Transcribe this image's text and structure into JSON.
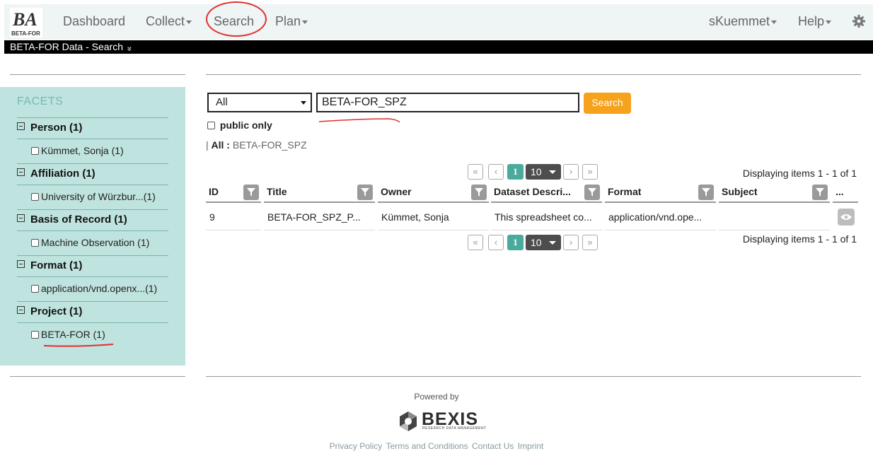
{
  "navbar": {
    "logo_text": "BA",
    "logo_sub": "BETA-FOR",
    "items": [
      {
        "label": "Dashboard",
        "has_caret": false
      },
      {
        "label": "Collect",
        "has_caret": true
      },
      {
        "label": "Search",
        "has_caret": false
      },
      {
        "label": "Plan",
        "has_caret": true
      }
    ],
    "user": "sKuemmet",
    "help": "Help"
  },
  "subbar": {
    "title": "BETA-FOR Data - Search",
    "chevron": "»"
  },
  "facets": {
    "title": "FACETS",
    "groups": [
      {
        "head": "Person (1)",
        "item": "Kümmet, Sonja (1)"
      },
      {
        "head": "Affiliation (1)",
        "item": "University of Würzbur...(1)"
      },
      {
        "head": "Basis of Record (1)",
        "item": "Machine Observation (1)"
      },
      {
        "head": "Format (1)",
        "item": "application/vnd.openx...(1)"
      },
      {
        "head": "Project (1)",
        "item": "BETA-FOR (1)"
      }
    ]
  },
  "search": {
    "category": "All",
    "query": "BETA-FOR_SPZ",
    "button": "Search",
    "public_only": "public only",
    "crumb_label": "All :",
    "crumb_value": "BETA-FOR_SPZ"
  },
  "pager": {
    "first": "«",
    "prev": "‹",
    "current": "1",
    "page_size": "10",
    "next": "›",
    "last": "»",
    "display": "Displaying items 1 - 1 of 1"
  },
  "table": {
    "headers": [
      "ID",
      "Title",
      "Owner",
      "Dataset Descri...",
      "Format",
      "Subject",
      "..."
    ],
    "row": [
      "9",
      "BETA-FOR_SPZ_P...",
      "Kümmet, Sonja",
      "This spreadsheet co...",
      "application/vnd.ope..."
    ]
  },
  "footer": {
    "powered_by": "Powered by",
    "brand": "BEXIS",
    "brand_tag": "RESEARCH DATA MANAGEMENT",
    "links": [
      "Privacy Policy",
      "Terms and Conditions",
      "Contact Us",
      "Imprint"
    ]
  },
  "colors": {
    "accent": "#4aab9c",
    "search_button": "#f6a21c",
    "facet_bg": "#bfe3de",
    "annotation": "#e03030"
  }
}
